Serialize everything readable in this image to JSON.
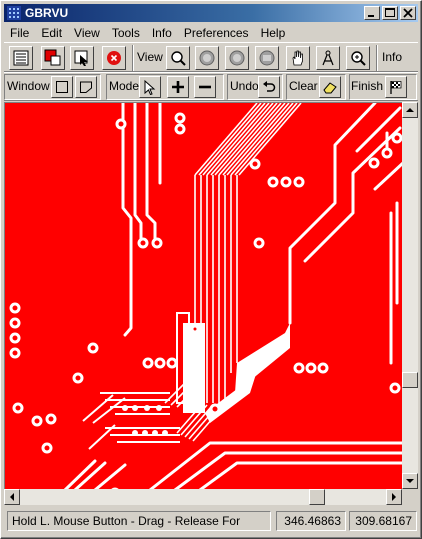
{
  "window": {
    "title": "GBRVU"
  },
  "title_buttons": {
    "minimize": "_",
    "maximize": "□",
    "close": "✕"
  },
  "menu": [
    "File",
    "Edit",
    "View",
    "Tools",
    "Info",
    "Preferences",
    "Help"
  ],
  "toolbar1": {
    "view_label": "View",
    "info_label": "Info"
  },
  "toolbar2": {
    "window_label": "Window",
    "mode_label": "Mode",
    "undo_label": "Undo",
    "clear_label": "Clear",
    "finish_label": "Finish"
  },
  "status": {
    "message": "Hold L. Mouse Button - Drag - Release For",
    "x_coord": "346.46863",
    "y_coord": "309.68167"
  },
  "colors": {
    "board": "#ff0000",
    "trace": "#ffffff",
    "titlebar": "#0a246a"
  }
}
